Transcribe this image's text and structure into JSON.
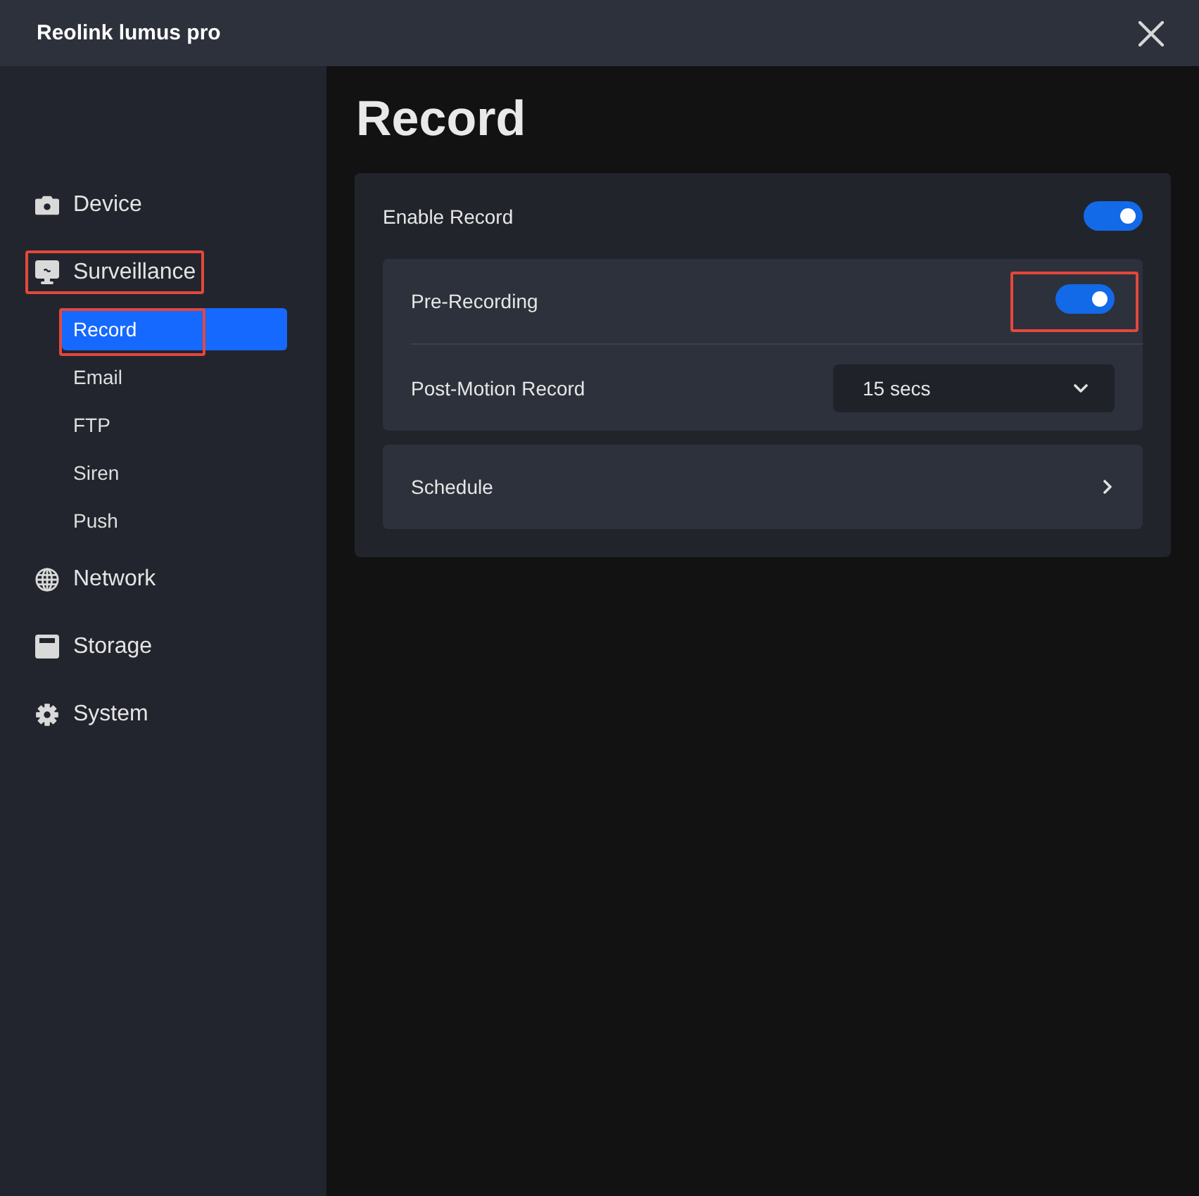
{
  "window": {
    "title": "Reolink lumus pro"
  },
  "sidebar": {
    "items": [
      {
        "label": "Device",
        "selected": false,
        "highlighted": false
      },
      {
        "label": "Surveillance",
        "selected": false,
        "highlighted": true,
        "children": [
          {
            "label": "Record",
            "selected": true,
            "highlighted": true
          },
          {
            "label": "Email",
            "selected": false,
            "highlighted": false
          },
          {
            "label": "FTP",
            "selected": false,
            "highlighted": false
          },
          {
            "label": "Siren",
            "selected": false,
            "highlighted": false
          },
          {
            "label": "Push",
            "selected": false,
            "highlighted": false
          }
        ]
      },
      {
        "label": "Network",
        "selected": false,
        "highlighted": false
      },
      {
        "label": "Storage",
        "selected": false,
        "highlighted": false
      },
      {
        "label": "System",
        "selected": false,
        "highlighted": false
      }
    ]
  },
  "page": {
    "title": "Record",
    "enable_record": {
      "label": "Enable Record",
      "on": true
    },
    "options": [
      {
        "kind": "toggle",
        "label": "Pre-Recording",
        "on": true,
        "highlighted": true
      },
      {
        "kind": "dropdown",
        "label": "Post-Motion Record",
        "value": "15 secs"
      }
    ],
    "schedule": {
      "label": "Schedule"
    }
  }
}
